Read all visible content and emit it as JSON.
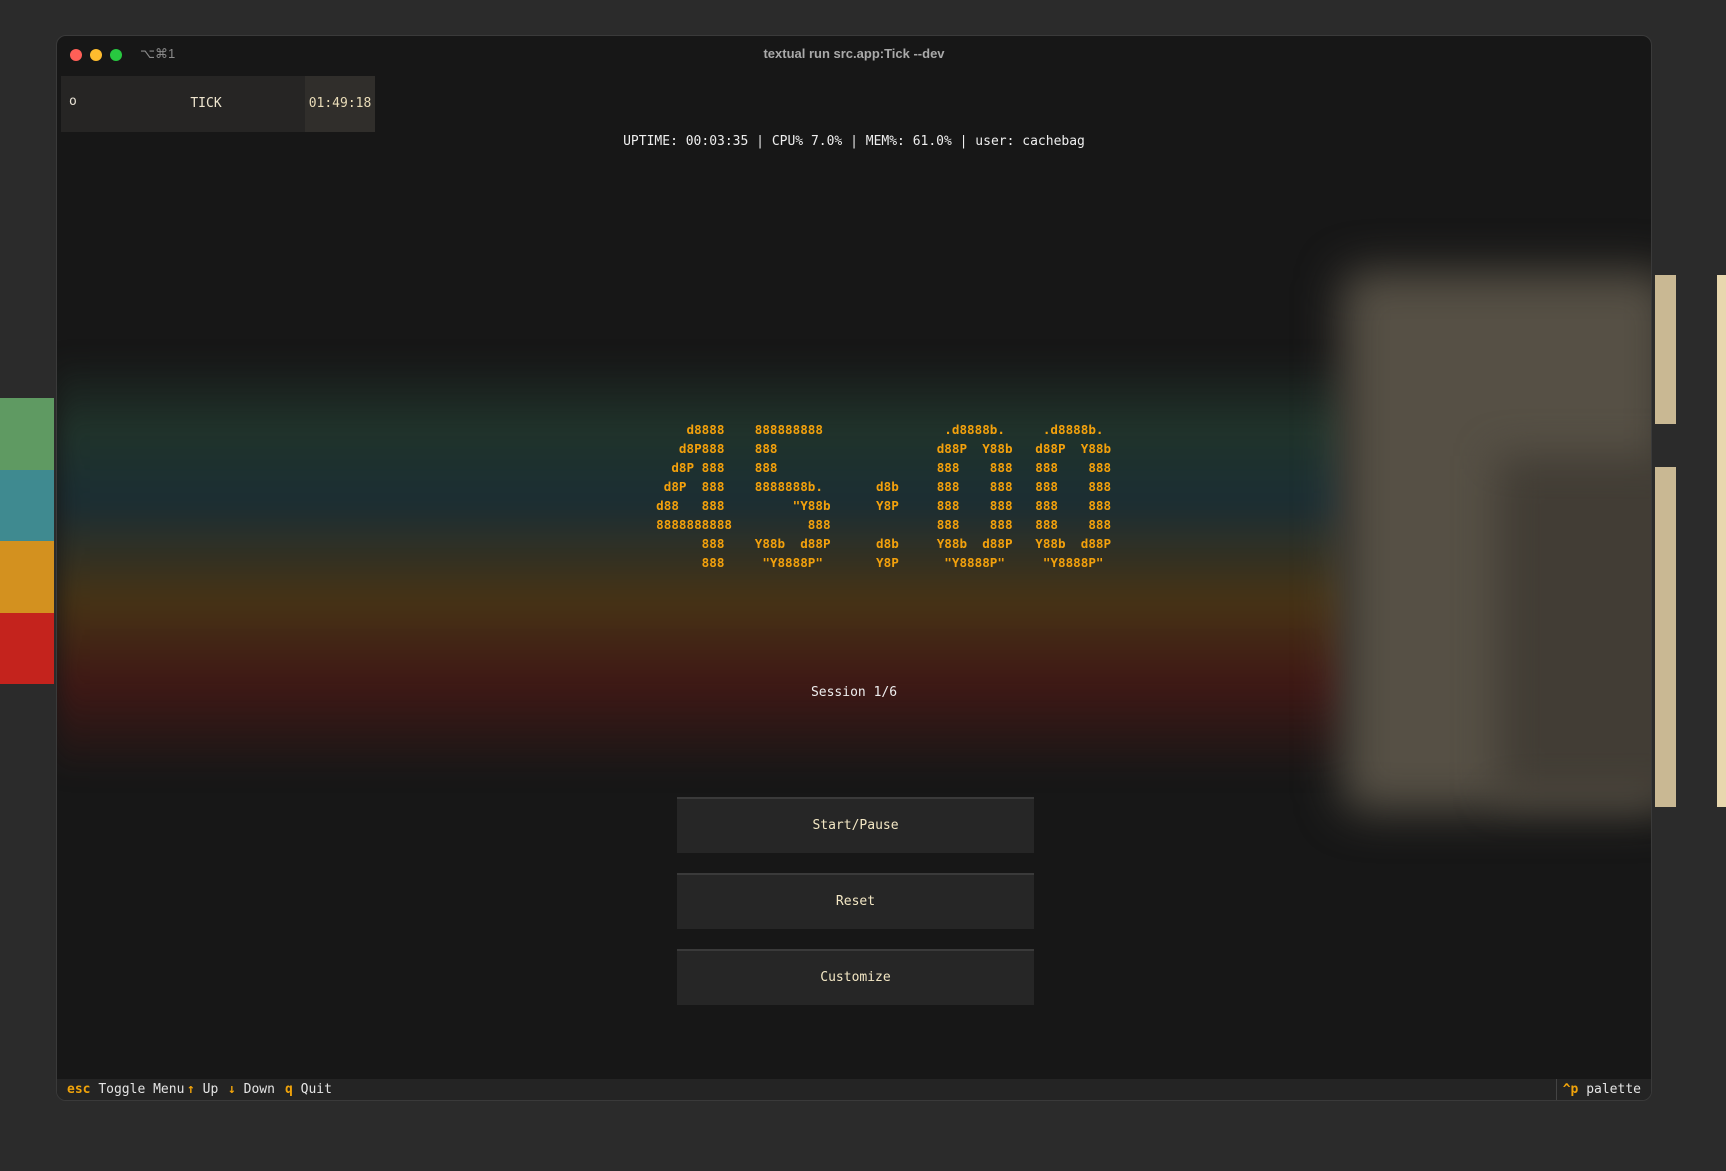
{
  "window": {
    "title": "textual run src.app:Tick --dev",
    "shortcut": "⌥⌘1"
  },
  "header": {
    "icon": "o",
    "title": "TICK",
    "clock": "01:49:18"
  },
  "status_line": "UPTIME: 00:03:35 | CPU% 7.0% | MEM%: 61.0% | user: cachebag",
  "timer_art": "      d8888    888888888                .d8888b.     .d8888b.\n     d8P888    888                     d88P  Y88b   d88P  Y88b\n    d8P 888    888                     888    888   888    888\n   d8P  888    8888888b.       d8b     888    888   888    888\n  d88   888         \"Y88b      Y8P     888    888   888    888\n  8888888888          888              888    888   888    888\n        888    Y88b  d88P      d8b     Y88b  d88P   Y88b  d88P\n        888     \"Y8888P\"       Y8P      \"Y8888P\"     \"Y8888P\"",
  "session_label": "Session 1/6",
  "buttons": {
    "start_pause": "Start/Pause",
    "reset": "Reset",
    "customize": "Customize"
  },
  "footer": {
    "bindings": [
      {
        "key": "esc",
        "label": "Toggle Menu"
      },
      {
        "key": "↑",
        "label": "Up"
      },
      {
        "key": "↓",
        "label": "Down"
      },
      {
        "key": "q",
        "label": "Quit"
      }
    ],
    "palette_key": "^p",
    "palette_label": "palette"
  },
  "colors": {
    "accent": "#f3a10c",
    "background": "#171717",
    "button": "#262626"
  }
}
